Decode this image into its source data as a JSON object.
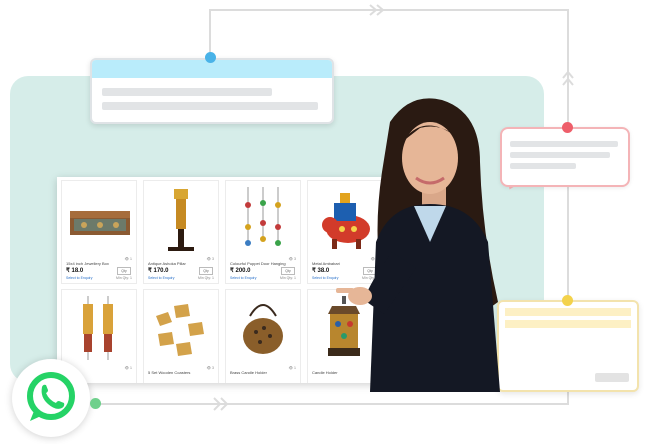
{
  "products": [
    {
      "name": "15x4 inch Jewellery Box",
      "price": "₹ 18.0",
      "qty": "Qty",
      "views": "👁 1",
      "enquiry": "Select to Enquiry",
      "min_qty": "Min Qty: 1"
    },
    {
      "name": "Antique Ashoka Pillar",
      "price": "₹ 170.0",
      "qty": "Qty",
      "views": "👁 3",
      "enquiry": "Select to Enquiry",
      "min_qty": "Min Qty: 1"
    },
    {
      "name": "Colourful Puppet Door Hanging",
      "price": "₹ 200.0",
      "qty": "Qty",
      "views": "👁 3",
      "enquiry": "Select to Enquiry",
      "min_qty": "Min Qty: 1"
    },
    {
      "name": "Metal Ambabari",
      "price": "₹ 38.0",
      "qty": "Qty",
      "views": "👁 1",
      "enquiry": "Select to Enquiry",
      "min_qty": "Min Qty: 1"
    },
    {
      "name": "",
      "price": "",
      "qty": "",
      "views": "👁 1",
      "enquiry": "",
      "min_qty": ""
    },
    {
      "name": "5 Set Wooden Coasters",
      "price": "",
      "qty": "",
      "views": "👁 3",
      "enquiry": "",
      "min_qty": ""
    },
    {
      "name": "Brass Candle Holder",
      "price": "",
      "qty": "",
      "views": "👁 1",
      "enquiry": "",
      "min_qty": ""
    },
    {
      "name": "Candle Holder",
      "price": "",
      "qty": "",
      "views": "👁 1",
      "enquiry": "",
      "min_qty": ""
    }
  ],
  "colors": {
    "teal_panel": "#d6ede9",
    "connector": "#dcdcdc",
    "blue_dot": "#4ab3e8",
    "pink_dot": "#ee5e6a",
    "yellow_dot": "#f3d24b",
    "green_dot": "#6fd08c",
    "whatsapp_green": "#25d366"
  },
  "icons": {
    "whatsapp": "whatsapp-icon",
    "chevrons": "chevron-right-icon"
  }
}
